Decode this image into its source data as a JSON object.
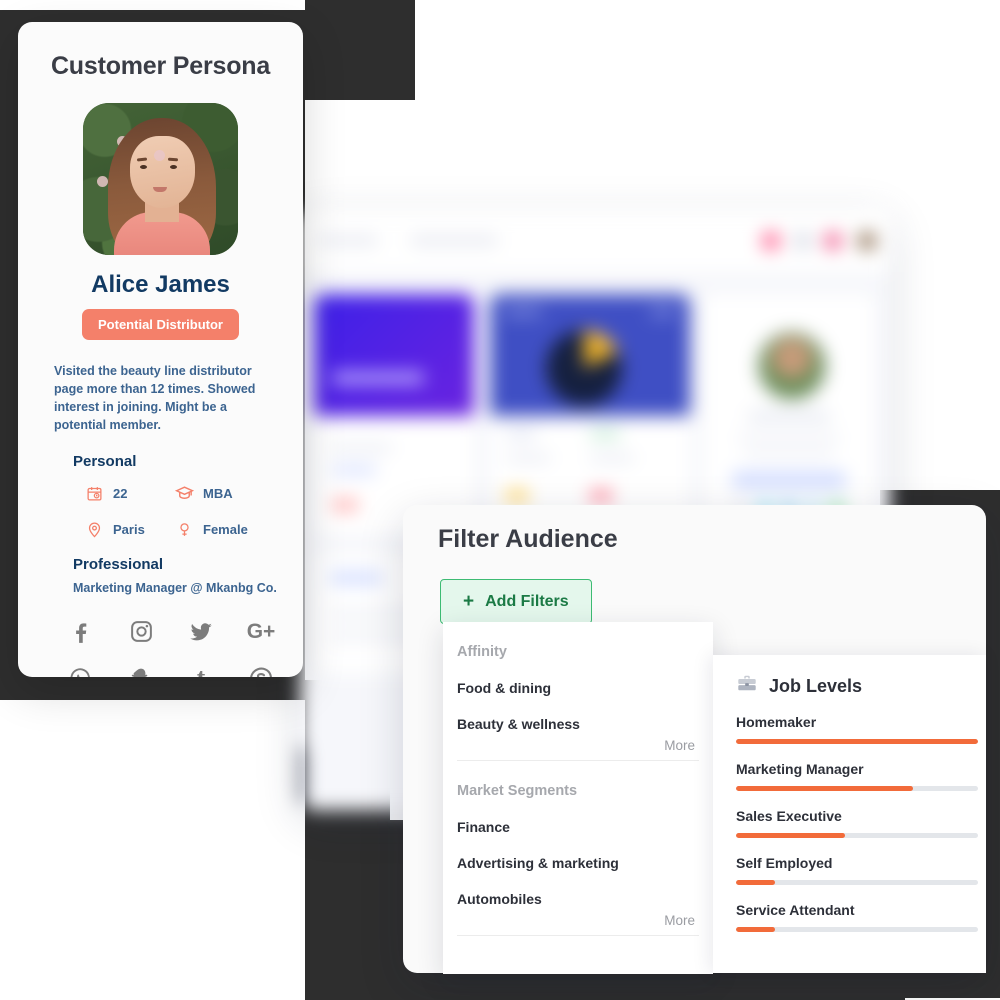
{
  "persona": {
    "title": "Customer Persona",
    "avatar_alt": "persona-photo",
    "name": "Alice James",
    "badge": "Potential Distributor",
    "description": "Visited the beauty line distributor page more than 12 times. Showed interest in joining. Might be a potential member.",
    "personal_heading": "Personal",
    "facts": [
      {
        "icon": "calendar-icon",
        "value": "22"
      },
      {
        "icon": "graduation-cap-icon",
        "value": "MBA"
      },
      {
        "icon": "location-pin-icon",
        "value": "Paris"
      },
      {
        "icon": "female-gender-icon",
        "value": "Female"
      }
    ],
    "professional_heading": "Professional",
    "professional_value": "Marketing Manager @ Mkanbg Co.",
    "socials": [
      {
        "icon": "facebook-icon",
        "glyph": "f"
      },
      {
        "icon": "instagram-icon",
        "glyph": ""
      },
      {
        "icon": "twitter-icon",
        "glyph": ""
      },
      {
        "icon": "google-plus-icon",
        "glyph": "G+"
      },
      {
        "icon": "whatsapp-icon",
        "glyph": ""
      },
      {
        "icon": "snapchat-icon",
        "glyph": ""
      },
      {
        "icon": "tumblr-icon",
        "glyph": "t"
      },
      {
        "icon": "skype-icon",
        "glyph": "S"
      }
    ],
    "colors": {
      "name": "#123A63",
      "badge_bg": "#F4806A",
      "accent": "#F4806A",
      "body_text": "#3C6490"
    }
  },
  "filter": {
    "title": "Filter Audience",
    "add_filters_label": "Add Filters",
    "add_filters_plus": "+",
    "dropdown": {
      "groups": [
        {
          "label": "Affinity",
          "items": [
            "Food & dining",
            "Beauty & wellness"
          ],
          "more": "More"
        },
        {
          "label": "Market Segments",
          "items": [
            "Finance",
            "Advertising & marketing",
            "Automobiles"
          ],
          "more": "More"
        }
      ]
    },
    "colors": {
      "button_bg": "#E4F7EC",
      "button_border": "#3DBB73",
      "button_text": "#1B7A45"
    }
  },
  "job_levels": {
    "icon": "briefcase-icon",
    "title": "Job Levels",
    "bar_color": "#F26B3A",
    "track_color": "#E3E6EA",
    "rows": [
      {
        "label": "Homemaker",
        "percent": 100
      },
      {
        "label": "Marketing Manager",
        "percent": 73
      },
      {
        "label": "Sales Executive",
        "percent": 45
      },
      {
        "label": "Self Employed",
        "percent": 16
      },
      {
        "label": "Service Attendant",
        "percent": 16
      }
    ]
  }
}
